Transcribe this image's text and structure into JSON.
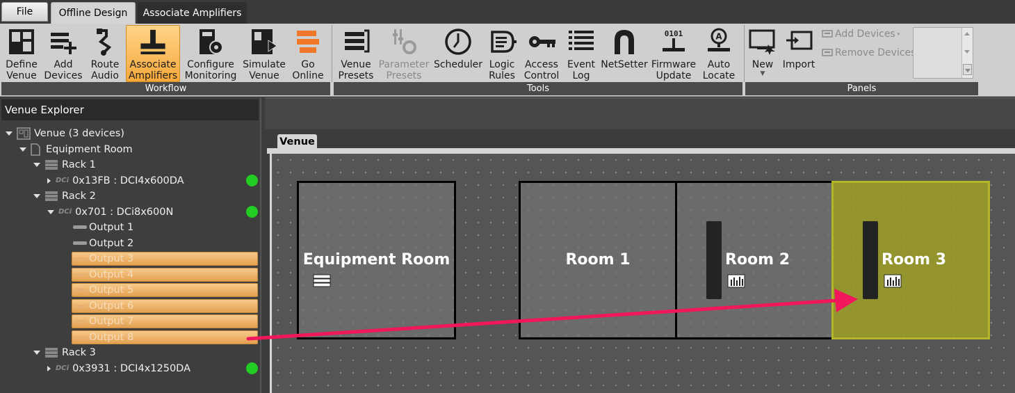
{
  "tabs": {
    "file": "File",
    "offline_design": "Offline Design",
    "associate_amplifiers": "Associate Amplifiers"
  },
  "ribbon": {
    "workflow": {
      "title": "Workflow",
      "buttons": [
        {
          "label": "Define\nVenue",
          "icon": "define-venue-icon"
        },
        {
          "label": "Add\nDevices",
          "icon": "add-devices-icon"
        },
        {
          "label": "Route\nAudio",
          "icon": "route-audio-icon"
        },
        {
          "label": "Associate\nAmplifiers",
          "icon": "associate-amplifiers-icon",
          "active": true
        },
        {
          "label": "Configure\nMonitoring",
          "icon": "configure-monitoring-icon"
        },
        {
          "label": "Simulate\nVenue",
          "icon": "simulate-venue-icon"
        },
        {
          "label": "Go\nOnline",
          "icon": "go-online-icon"
        }
      ]
    },
    "tools": {
      "title": "Tools",
      "buttons": [
        {
          "label": "Venue\nPresets",
          "icon": "venue-presets-icon"
        },
        {
          "label": "Parameter\nPresets",
          "icon": "parameter-presets-icon",
          "disabled": true
        },
        {
          "label": "Scheduler",
          "icon": "scheduler-clock-icon"
        },
        {
          "label": "Logic\nRules",
          "icon": "logic-rules-icon"
        },
        {
          "label": "Access\nControl",
          "icon": "key-icon"
        },
        {
          "label": "Event\nLog",
          "icon": "event-log-icon"
        },
        {
          "label": "NetSetter",
          "icon": "magnet-icon"
        },
        {
          "label": "Firmware\nUpdate",
          "icon": "firmware-update-icon"
        },
        {
          "label": "Auto\nLocate",
          "icon": "auto-locate-icon"
        }
      ]
    },
    "panels": {
      "title": "Panels",
      "new_label": "New",
      "import_label": "Import",
      "add_devices_label": "Add Devices",
      "remove_devices_label": "Remove Devices"
    }
  },
  "explorer": {
    "title": "Venue Explorer",
    "venue": "Venue (3 devices)",
    "equipment_room": "Equipment Room",
    "rack1": "Rack 1",
    "device1": "0x13FB : DCI4x600DA",
    "rack2": "Rack 2",
    "device2": "0x701 : DCi8x600N",
    "outputs": [
      "Output 1",
      "Output 2",
      "Output 3",
      "Output 4",
      "Output 5",
      "Output 6",
      "Output 7",
      "Output 8"
    ],
    "rack3": "Rack 3",
    "device3": "0x3931 : DCI4x1250DA",
    "dci_badge": "DCi",
    "status_color": "#22cc22"
  },
  "canvas": {
    "tab": "Venue",
    "rooms": [
      "Equipment Room",
      "Room 1",
      "Room 2",
      "Room 3"
    ],
    "selection_color": "#b5b52a",
    "arrow_color": "#f0185a"
  }
}
